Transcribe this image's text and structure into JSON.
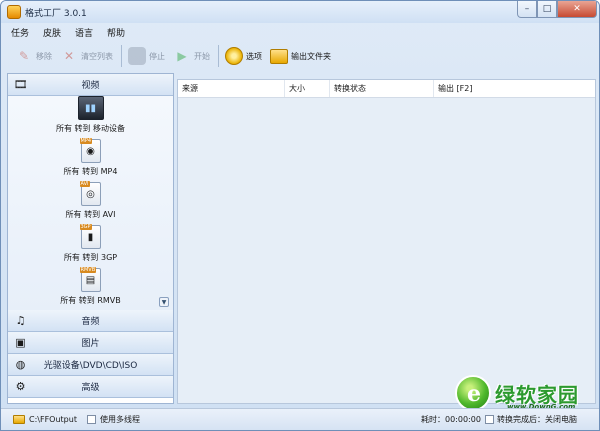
{
  "window": {
    "title": "格式工厂 3.0.1",
    "min_symbol": "–",
    "max_symbol": "□",
    "close_symbol": "✕"
  },
  "menu": [
    "任务",
    "皮肤",
    "语言",
    "帮助"
  ],
  "toolbar": {
    "remove": {
      "label": "移除",
      "icon": "remove-file-icon",
      "enabled": false
    },
    "clear_list": {
      "label": "清空列表",
      "icon": "clear-list-icon",
      "enabled": false
    },
    "stop": {
      "label": "停止",
      "icon": "stop-icon",
      "enabled": false
    },
    "start": {
      "label": "开始",
      "icon": "start-icon",
      "enabled": false
    },
    "options": {
      "label": "选项",
      "icon": "options-icon",
      "enabled": true
    },
    "output_folder": {
      "label": "输出文件夹",
      "icon": "output-folder-icon",
      "enabled": true
    }
  },
  "left_panel": {
    "categories": {
      "video": {
        "label": "视频",
        "icon": "film-icon"
      },
      "audio": {
        "label": "音频",
        "icon": "music-icon"
      },
      "picture": {
        "label": "图片",
        "icon": "picture-icon"
      },
      "rom": {
        "label": "光驱设备\\DVD\\CD\\ISO",
        "icon": "disc-drive-icon"
      },
      "advanced": {
        "label": "高级",
        "icon": "advanced-icon"
      }
    },
    "video_formats": [
      {
        "label": "所有 转到 移动设备",
        "icon": "mobile-device-icon",
        "tag": ""
      },
      {
        "label": "所有 转到 MP4",
        "icon": "mp4-file-icon",
        "tag": "MP4"
      },
      {
        "label": "所有 转到 AVI",
        "icon": "avi-file-icon",
        "tag": "AVI"
      },
      {
        "label": "所有 转到 3GP",
        "icon": "3gp-file-icon",
        "tag": "3GP"
      },
      {
        "label": "所有 转到 RMVB",
        "icon": "rmvb-file-icon",
        "tag": "RMVB"
      }
    ],
    "scroll_symbol": "▼"
  },
  "file_list": {
    "columns": {
      "source": "来源",
      "size": "大小",
      "status": "转换状态",
      "output": "输出 [F2]"
    },
    "rows": []
  },
  "statusbar": {
    "output_path": "C:\\FFOutput",
    "multithread_label": "使用多线程",
    "multithread_checked": false,
    "elapsed": "耗时：00:00:00",
    "after_convert_checked": false,
    "after_convert_label": "转换完成后：关闭电脑"
  },
  "watermark": {
    "text": "绿软家园",
    "url": "www.DownG.com"
  },
  "colors": {
    "window_bg": "#cfe0f3",
    "list_bg": "#e6eef7",
    "accent_green": "#2c9a2f"
  }
}
